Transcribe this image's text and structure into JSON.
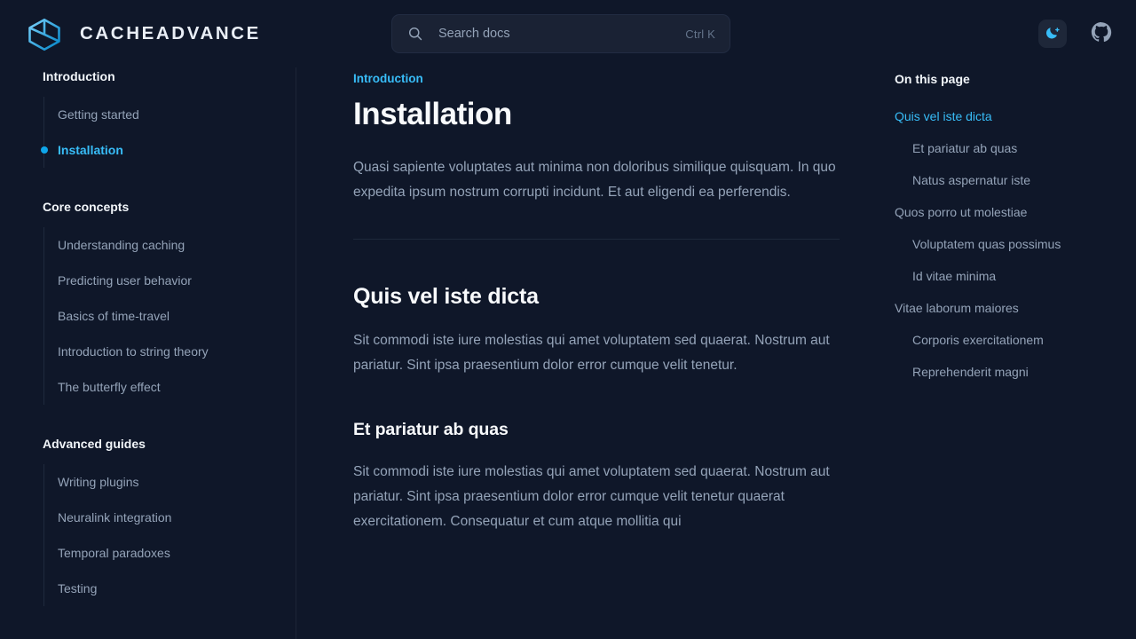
{
  "header": {
    "brand_name": "CACHEADVANCE",
    "logo_icon": "cube-logo-icon",
    "search": {
      "icon": "search-icon",
      "placeholder": "Search docs",
      "value": "",
      "shortcut": "Ctrl K"
    },
    "theme_toggle_icon": "moon-sparkle-icon",
    "github_icon": "github-icon"
  },
  "sidebar": {
    "sections": [
      {
        "title": "Introduction",
        "items": [
          {
            "label": "Getting started",
            "active": false
          },
          {
            "label": "Installation",
            "active": true
          }
        ]
      },
      {
        "title": "Core concepts",
        "items": [
          {
            "label": "Understanding caching",
            "active": false
          },
          {
            "label": "Predicting user behavior",
            "active": false
          },
          {
            "label": "Basics of time-travel",
            "active": false
          },
          {
            "label": "Introduction to string theory",
            "active": false
          },
          {
            "label": "The butterfly effect",
            "active": false
          }
        ]
      },
      {
        "title": "Advanced guides",
        "items": [
          {
            "label": "Writing plugins",
            "active": false
          },
          {
            "label": "Neuralink integration",
            "active": false
          },
          {
            "label": "Temporal paradoxes",
            "active": false
          },
          {
            "label": "Testing",
            "active": false
          }
        ]
      }
    ]
  },
  "main": {
    "breadcrumb": "Introduction",
    "title": "Installation",
    "intro": "Quasi sapiente voluptates aut minima non doloribus similique quisquam. In quo expedita ipsum nostrum corrupti incidunt. Et aut eligendi ea perferendis.",
    "section_1": {
      "heading": "Quis vel iste dicta",
      "body": "Sit commodi iste iure molestias qui amet voluptatem sed quaerat. Nostrum aut pariatur. Sint ipsa praesentium dolor error cumque velit tenetur."
    },
    "section_1_sub_1": {
      "heading": "Et pariatur ab quas",
      "body": "Sit commodi iste iure molestias qui amet voluptatem sed quaerat. Nostrum aut pariatur. Sint ipsa praesentium dolor error cumque velit tenetur quaerat exercitationem. Consequatur et cum atque mollitia qui"
    }
  },
  "toc": {
    "title": "On this page",
    "items": [
      {
        "label": "Quis vel iste dicta",
        "level": 1,
        "active": true
      },
      {
        "label": "Et pariatur ab quas",
        "level": 2,
        "active": false
      },
      {
        "label": "Natus aspernatur iste",
        "level": 2,
        "active": false
      },
      {
        "label": "Quos porro ut molestiae",
        "level": 1,
        "active": false
      },
      {
        "label": "Voluptatem quas possimus",
        "level": 2,
        "active": false
      },
      {
        "label": "Id vitae minima",
        "level": 2,
        "active": false
      },
      {
        "label": "Vitae laborum maiores",
        "level": 1,
        "active": false
      },
      {
        "label": "Corporis exercitationem",
        "level": 2,
        "active": false
      },
      {
        "label": "Reprehenderit magni",
        "level": 2,
        "active": false
      }
    ]
  },
  "colors": {
    "background": "#0f1729",
    "accent": "#38bdf8",
    "accent_strong": "#0ea5e9",
    "text_primary": "#f8fafc",
    "text_muted": "#94a3b8",
    "border": "#1e293b"
  }
}
